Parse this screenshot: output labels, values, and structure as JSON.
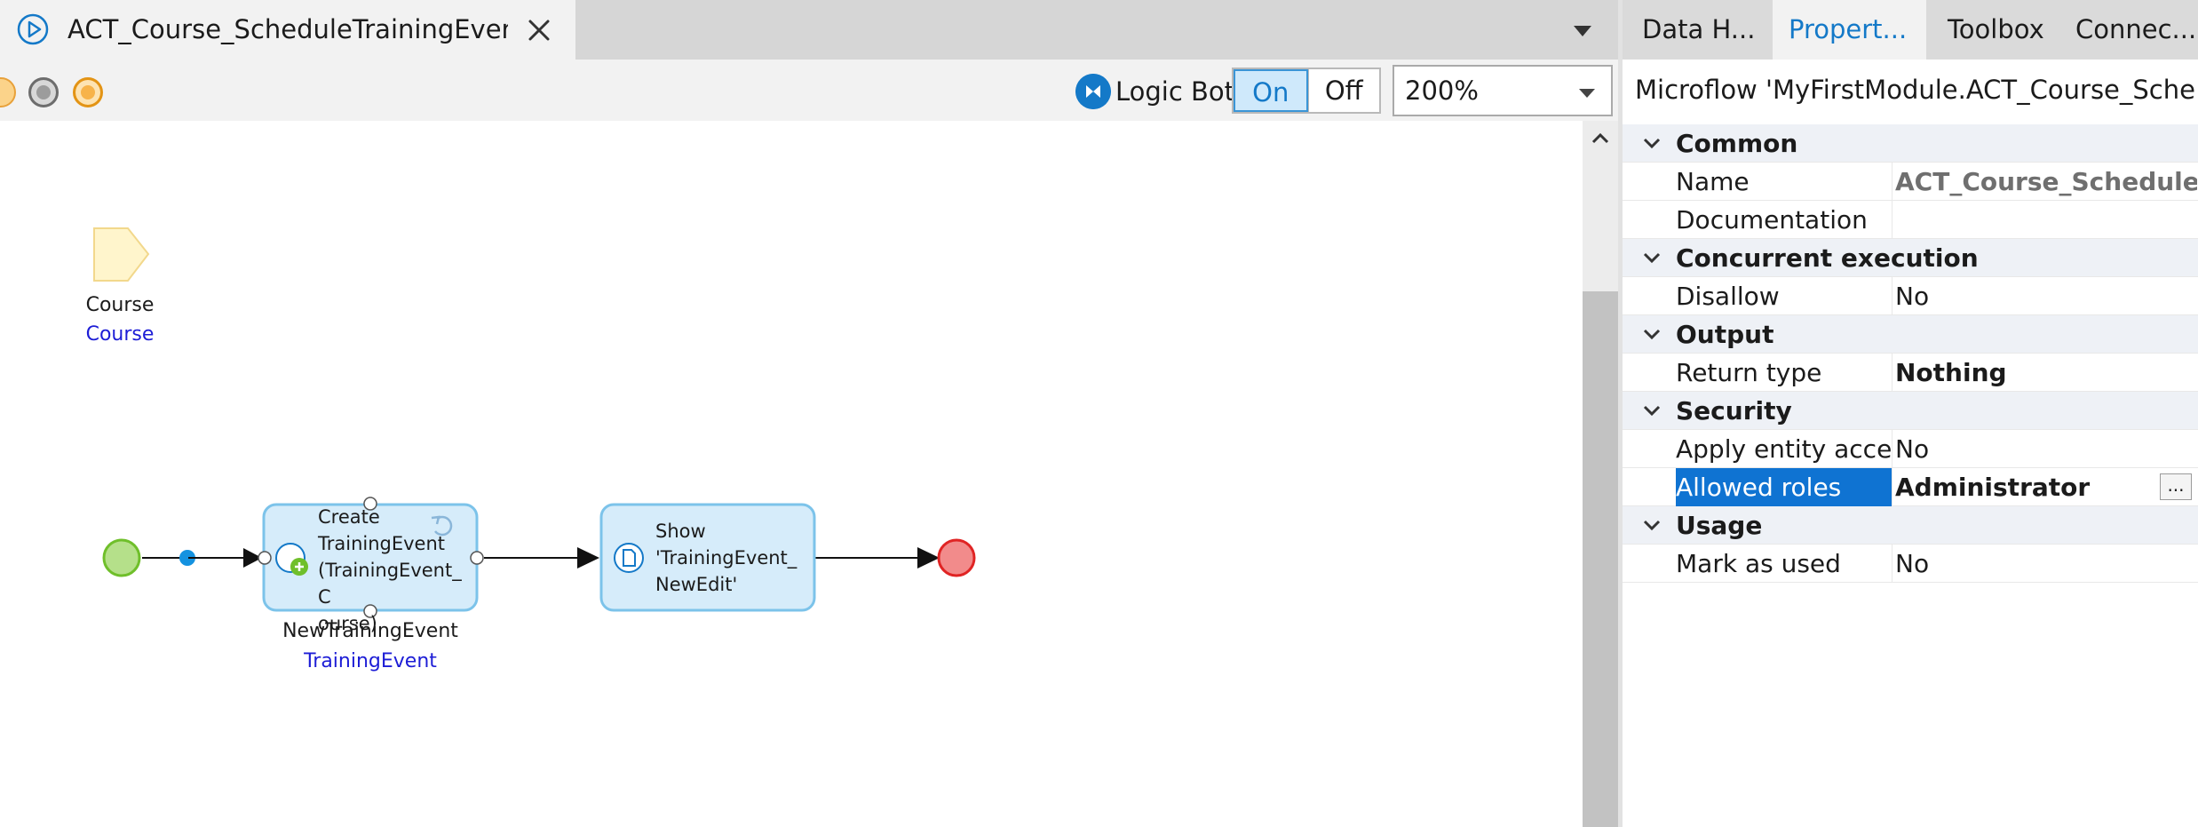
{
  "editor": {
    "tab": {
      "title": "ACT_Course_ScheduleTrainingEvent [l",
      "icon": "microflow-play-icon",
      "close_icon": "close-icon"
    },
    "tab_dropdown_icon": "chevron-down-icon",
    "toolbar": {
      "logic_bot_label": "Logic Bot",
      "toggle_on": "On",
      "toggle_off": "Off",
      "toggle_state": "On",
      "zoom": "200%"
    },
    "diagram": {
      "parameter": {
        "name": "Course",
        "type": "Course"
      },
      "create_activity": {
        "text": "Create\nTrainingEvent\n(TrainingEvent_C\nourse)",
        "output_name": "NewTrainingEvent",
        "output_type": "TrainingEvent"
      },
      "show_activity": {
        "text": "Show\n'TrainingEvent_\nNewEdit'"
      },
      "colors": {
        "activity_fill": "#d6ecfa",
        "activity_border": "#7cc3ea",
        "start": "#b5e08a",
        "end": "#f28b8b"
      }
    }
  },
  "panel": {
    "tabs": [
      {
        "label": "Data H...",
        "active": false
      },
      {
        "label": "Propert...",
        "active": true
      },
      {
        "label": "Toolbox",
        "active": false
      },
      {
        "label": "Connec...",
        "active": false
      }
    ],
    "title": "Microflow 'MyFirstModule.ACT_Course_Sche...",
    "groups": {
      "common": "Common",
      "concurrent": "Concurrent execution",
      "output": "Output",
      "security": "Security",
      "usage": "Usage"
    },
    "props": {
      "name": {
        "label": "Name",
        "value": "ACT_Course_ScheduleTra"
      },
      "documentation": {
        "label": "Documentation",
        "value": ""
      },
      "disallow": {
        "label": "Disallow",
        "value": "No"
      },
      "return_type": {
        "label": "Return type",
        "value": "Nothing"
      },
      "apply_entity": {
        "label": "Apply entity acces",
        "value": "No"
      },
      "allowed_roles": {
        "label": "Allowed roles",
        "value": "Administrator",
        "button": "..."
      },
      "mark_as_used": {
        "label": "Mark as used",
        "value": "No"
      }
    },
    "accent_color": "#1479c8",
    "selection_color": "#0f73d2"
  }
}
